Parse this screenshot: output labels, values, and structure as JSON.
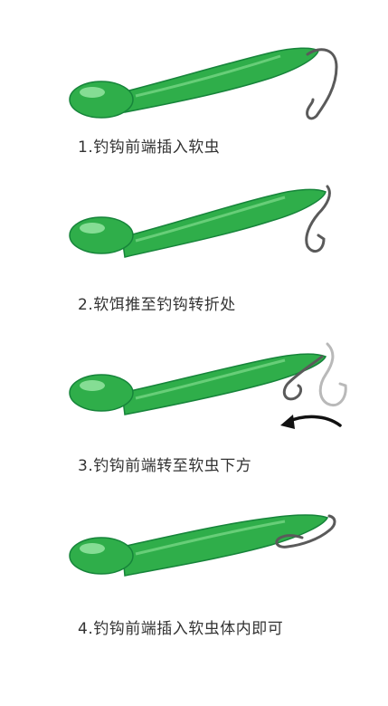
{
  "colors": {
    "lure_body": "#2fae4a",
    "lure_dark": "#16843a",
    "lure_light": "#7fdc8c",
    "hook": "#5a5a5a",
    "hook_ghost": "#b9b9b9",
    "arrow": "#111111",
    "caption_text": "#333333",
    "background": "#ffffff"
  },
  "steps": [
    {
      "caption": "1.钓钩前端插入软虫"
    },
    {
      "caption": "2.软饵推至钓钩转折处"
    },
    {
      "caption": "3.钓钩前端转至软虫下方"
    },
    {
      "caption": "4.钓钩前端插入软虫体内即可"
    }
  ]
}
